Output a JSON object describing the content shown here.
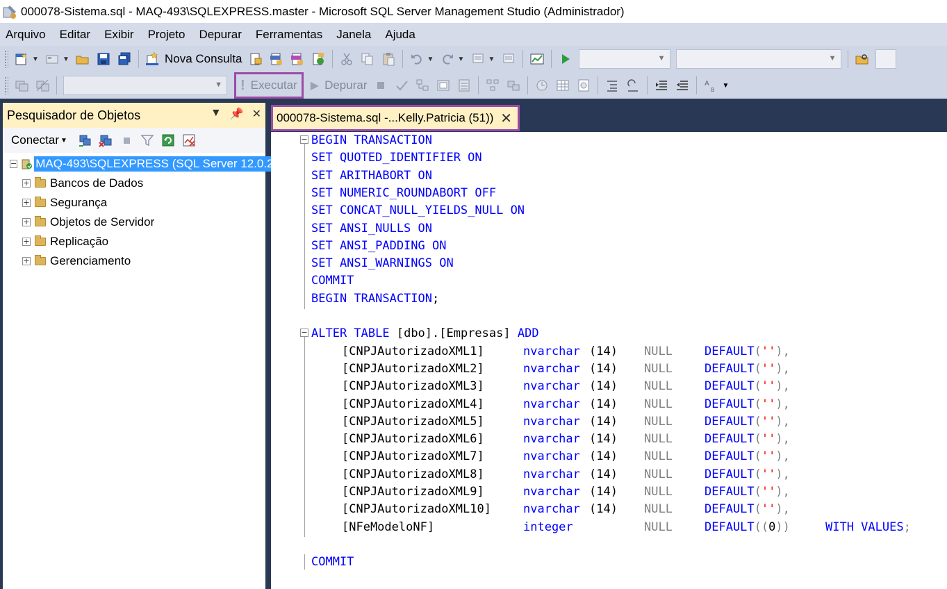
{
  "window": {
    "title": "000078-Sistema.sql - MAQ-493\\SQLEXPRESS.master  - Microsoft SQL Server Management Studio (Administrador)"
  },
  "menu": [
    "Arquivo",
    "Editar",
    "Exibir",
    "Projeto",
    "Depurar",
    "Ferramentas",
    "Janela",
    "Ajuda"
  ],
  "toolbar1": {
    "new_query_label": "Nova Consulta"
  },
  "toolbar2": {
    "execute_label": "Executar",
    "debug_label": "Depurar"
  },
  "object_explorer": {
    "title": "Pesquisador de Objetos",
    "connect_label": "Conectar",
    "server_label": "MAQ-493\\SQLEXPRESS (SQL Server 12.0.2",
    "nodes": [
      "Bancos de Dados",
      "Segurança",
      "Objetos de Servidor",
      "Replicação",
      "Gerenciamento"
    ]
  },
  "editor": {
    "tab_label": "000078-Sistema.sql -...Kelly.Patricia (51))",
    "header_lines": [
      "BEGIN TRANSACTION",
      "SET QUOTED_IDENTIFIER ON",
      "SET ARITHABORT ON",
      "SET NUMERIC_ROUNDABORT OFF",
      "SET CONCAT_NULL_YIELDS_NULL ON",
      "SET ANSI_NULLS ON",
      "SET ANSI_PADDING ON",
      "SET ANSI_WARNINGS ON",
      "COMMIT",
      "BEGIN TRANSACTION;"
    ],
    "alter": {
      "kw": "ALTER TABLE",
      "table": "[dbo].[Empresas]",
      "add": "ADD"
    },
    "columns": [
      {
        "name": "[CNPJAutorizadoXML1]",
        "type": "nvarchar",
        "size": "(14)",
        "null": "NULL",
        "def": "DEFAULT",
        "defval": "''",
        "tail": ","
      },
      {
        "name": "[CNPJAutorizadoXML2]",
        "type": "nvarchar",
        "size": "(14)",
        "null": "NULL",
        "def": "DEFAULT",
        "defval": "''",
        "tail": ","
      },
      {
        "name": "[CNPJAutorizadoXML3]",
        "type": "nvarchar",
        "size": "(14)",
        "null": "NULL",
        "def": "DEFAULT",
        "defval": "''",
        "tail": ","
      },
      {
        "name": "[CNPJAutorizadoXML4]",
        "type": "nvarchar",
        "size": "(14)",
        "null": "NULL",
        "def": "DEFAULT",
        "defval": "''",
        "tail": ","
      },
      {
        "name": "[CNPJAutorizadoXML5]",
        "type": "nvarchar",
        "size": "(14)",
        "null": "NULL",
        "def": "DEFAULT",
        "defval": "''",
        "tail": ","
      },
      {
        "name": "[CNPJAutorizadoXML6]",
        "type": "nvarchar",
        "size": "(14)",
        "null": "NULL",
        "def": "DEFAULT",
        "defval": "''",
        "tail": ","
      },
      {
        "name": "[CNPJAutorizadoXML7]",
        "type": "nvarchar",
        "size": "(14)",
        "null": "NULL",
        "def": "DEFAULT",
        "defval": "''",
        "tail": ","
      },
      {
        "name": "[CNPJAutorizadoXML8]",
        "type": "nvarchar",
        "size": "(14)",
        "null": "NULL",
        "def": "DEFAULT",
        "defval": "''",
        "tail": ","
      },
      {
        "name": "[CNPJAutorizadoXML9]",
        "type": "nvarchar",
        "size": "(14)",
        "null": "NULL",
        "def": "DEFAULT",
        "defval": "''",
        "tail": ","
      },
      {
        "name": "[CNPJAutorizadoXML10]",
        "type": "nvarchar",
        "size": "(14)",
        "null": "NULL",
        "def": "DEFAULT",
        "defval": "''",
        "tail": ","
      }
    ],
    "last_column": {
      "name": "[NFeModeloNF]",
      "type": "integer",
      "null": "NULL",
      "def": "DEFAULT",
      "defval_open": "((",
      "defval": "0",
      "defval_close": "))",
      "extra": "WITH VALUES",
      "tail": ";"
    },
    "footer": "COMMIT"
  },
  "colors": {
    "keyword": "#0000ff",
    "gray": "#808080",
    "string": "#ff0000",
    "highlight_border": "#9d4ba6",
    "selection": "#3399ff"
  }
}
